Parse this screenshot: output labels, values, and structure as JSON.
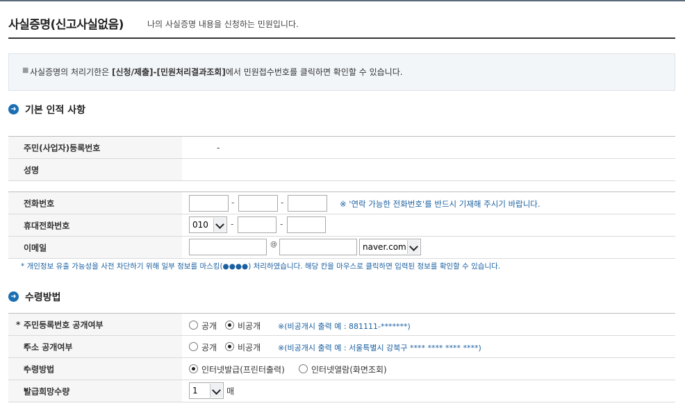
{
  "header": {
    "title": "사실증명(신고사실없음)",
    "subtitle": "나의 사실증명 내용을 신청하는 민원입니다."
  },
  "notice": {
    "text_prefix": "사실증명의 처리기한은 ",
    "text_bold": "[신청/제출]-[민원처리결과조회]",
    "text_suffix": "에서 민원접수번호를 클릭하면 확인할 수 있습니다."
  },
  "basic": {
    "section_title": "기본 인적 사항",
    "rrn_label": "주민(사업자)등록번호",
    "rrn_value": "-",
    "name_label": "성명",
    "name_value": "",
    "phone_label": "전화번호",
    "phone_hint": "※ '연락 가능한 전화번호'를 반드시 기재해 주시기 바랍니다.",
    "mobile_label": "휴대전화번호",
    "mobile_prefix": "010",
    "email_label": "이메일",
    "email_at": "@",
    "email_domain": "naver.com",
    "dash": "-",
    "privacy_note": "* 개인정보 유출 가능성을 사전 차단하기 위해 일부 정보를 마스킹(●●●●) 처리하였습니다. 해당 칸을 마우스로 클릭하면 입력된 정보를 확인할 수 있습니다."
  },
  "receive": {
    "section_title": "수령방법",
    "rrn_disclose_label": "주민등록번호 공개여부",
    "addr_disclose_label": "주소 공개여부",
    "method_label": "수령방법",
    "qty_label": "발급희망수량",
    "opt_public": "공개",
    "opt_private": "비공개",
    "rrn_example": "※(비공개시 출력 예 : 881111-*******)",
    "addr_example": "※(비공개시 출력 예 : 서울특별시 강북구 **** **** **** ****)",
    "method_opt1": "인터넷발급(프린터출력)",
    "method_opt2": "인터넷열람(화면조회)",
    "qty_value": "1",
    "qty_unit": "매",
    "required_mark": "*"
  }
}
